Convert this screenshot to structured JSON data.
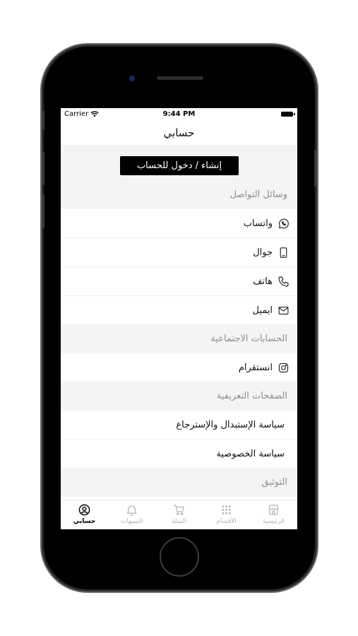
{
  "status_bar": {
    "carrier": "Carrier",
    "time": "9:44 PM"
  },
  "header": {
    "title": "حسابي"
  },
  "login_button": "إنشاء / دخول للحساب",
  "sections": {
    "contact": {
      "title": "وسائل التواصل",
      "items": [
        {
          "label": "واتساب",
          "icon": "whatsapp-icon"
        },
        {
          "label": "جوال",
          "icon": "mobile-icon"
        },
        {
          "label": "هاتف",
          "icon": "phone-icon"
        },
        {
          "label": "ايميل",
          "icon": "mail-icon"
        }
      ]
    },
    "social": {
      "title": "الحسابات الاجتماعية",
      "items": [
        {
          "label": "انستقرام",
          "icon": "instagram-icon"
        }
      ]
    },
    "pages": {
      "title": "الصفحات التعريفية",
      "items": [
        {
          "label": "سياسة الإستبدال والإسترجاع"
        },
        {
          "label": "سياسة الخصوصية"
        }
      ]
    },
    "verification": {
      "title": "التوثيق"
    }
  },
  "tabbar": {
    "active": "account",
    "items": [
      {
        "key": "home",
        "label": "الرئيسية",
        "icon": "store-icon"
      },
      {
        "key": "categories",
        "label": "الأقسام",
        "icon": "grid-icon"
      },
      {
        "key": "cart",
        "label": "السلة",
        "icon": "cart-icon"
      },
      {
        "key": "notifications",
        "label": "التنبيهات",
        "icon": "bell-icon"
      },
      {
        "key": "account",
        "label": "حسابي",
        "icon": "user-icon"
      }
    ]
  },
  "colors": {
    "accent": "#000000",
    "section_bg": "#f4f4f4",
    "muted_text": "#8e8e8e",
    "inactive_tab": "#b5b5b5"
  }
}
